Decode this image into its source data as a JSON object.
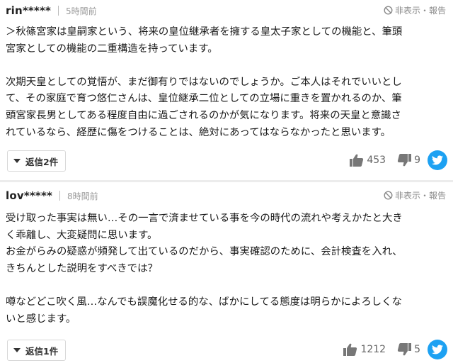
{
  "comments": [
    {
      "username": "rin*****",
      "time": "5時間前",
      "hide_report": "非表示・報告",
      "lines": [
        "＞秋篠宮家は皇嗣家という、将来の皇位継承者を擁する皇太子家としての機能と、筆頭",
        "宮家としての機能の二重構造を持っています。",
        "",
        "次期天皇としての覚悟が、まだ御有りではないのでしょうか。ご本人はそれでいいとし",
        "て、その家庭で育つ悠仁さんは、皇位継承二位としての立場に重きを置かれるのか、筆",
        "頭宮家長男としてある程度自由に過ごされるのかが気になります。将来の天皇と意識さ",
        "れているなら、経歴に傷をつけることは、絶対にあってはならなかったと思います。"
      ],
      "reply_label": "返信2件",
      "likes": "453",
      "dislikes": "9"
    },
    {
      "username": "lov*****",
      "time": "8時間前",
      "hide_report": "非表示・報告",
      "lines": [
        "受け取った事実は無い…その一言で済ませている事を今の時代の流れや考えかたと大き",
        "く乖離し、大変疑問に思います。",
        "お金がらみの疑惑が頻発して出ているのだから、事実確認のために、会計検査を入れ、",
        "きちんとした説明をすべきでは？",
        "",
        "噂などどこ吹く風…なんでも誤魔化せる的な、ばかにしてる態度は明らかによろしくな",
        "いと感じます。"
      ],
      "reply_label": "返信1件",
      "likes": "1212",
      "dislikes": "5"
    }
  ],
  "icons": {
    "hide": "prohibited-icon",
    "like": "thumbs-up-icon",
    "dislike": "thumbs-down-icon",
    "share": "twitter-icon",
    "reply": "caret-down-icon"
  },
  "colors": {
    "twitter": "#1da1f2",
    "divider": "#ececec",
    "muted": "#9a9a9a"
  }
}
